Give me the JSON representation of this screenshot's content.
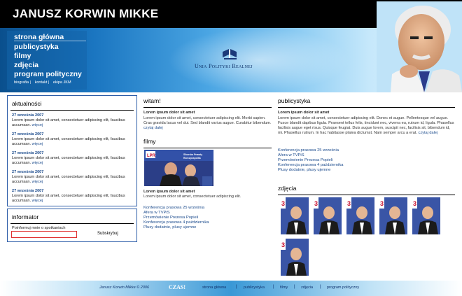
{
  "header": {
    "title": "JANUSZ KORWIN MIKKE",
    "logo_text": "Unia Polityki Realnej",
    "nav": [
      "strona główna",
      "publicystyka",
      "filmy",
      "zdjęcia",
      "program polityczny"
    ],
    "subnav": [
      "biografia",
      "kontakt",
      "ekipa JKM"
    ]
  },
  "aktualnosci": {
    "title": "aktualności",
    "items": [
      {
        "date": "27 września 2007",
        "text": "Lorem ipsum dolor sit amet, consectetuer adipiscing elit, faucibus accumsan.",
        "more": "więcej"
      },
      {
        "date": "27 września 2007",
        "text": "Lorem ipsum dolor sit amet, consectetuer adipiscing elit, faucibus accumsan.",
        "more": "więcej"
      },
      {
        "date": "27 września 2007",
        "text": "Lorem ipsum dolor sit amet, consectetuer adipiscing elit, faucibus accumsan.",
        "more": "więcej"
      },
      {
        "date": "27 września 2007",
        "text": "Lorem ipsum dolor sit amet, consectetuer adipiscing elit, faucibus accumsan.",
        "more": "więcej"
      },
      {
        "date": "27 września 2007",
        "text": "Lorem ipsum dolor sit amet, consectetuer adipiscing elit, faucibus accumsan.",
        "more": "więcej"
      }
    ]
  },
  "informator": {
    "title": "informator",
    "label": "Poinformuj mnie o spotkaniach",
    "input_value": "",
    "button": "Subskrybuj"
  },
  "witam": {
    "title": "witam!",
    "art_title": "Lorem ipsum dolor sit amet",
    "text": "Lorem ipsum dolor sit amet, consectetuer adipiscing elit. Morbi sapien. Cras gravida lacus vel dui. Sed blandit varius augue. Curabitur bibendum.",
    "more": "czytaj dalej"
  },
  "filmy": {
    "title": "filmy",
    "art_title": "Lorem ipsum dolor sit amet",
    "text": "Lorem ipsum dolor sit amet, consectetuer adipiscing elit.",
    "links": [
      "Konferencja prasowa 25 września",
      "Afera w TVPiS",
      "Przemówienie Prezesa Popieli",
      "Konferencja prasowa 4 października",
      "Plusy dodatnie, plusy ujemne"
    ]
  },
  "publicystyka": {
    "title": "publicystyka",
    "art_title": "Lorem ipsum dolor sit amet",
    "text": "Lorem ipsum dolor sit amet, consectetuer adipiscing elit. Donec et augue. Pellentesque vel augue. Fusce blandit dapibus ligula. Praesent tellus felis, tincidunt nec, viverra eu, rutrum id, ligula. Phasellus facilisis augue eget risus. Quisque feugiat. Duis augue lorem, suscipit nec, facilisis sit, bibendum id, mi. Phasellus rutrum. In hac habitasse platea dictumst. Nam semper arcu a erat.",
    "more": "czytaj dalej",
    "links": [
      "Konferencja prasowa 25 września",
      "Afera w TVPiS",
      "Przemówienie Prezesa Popieli",
      "Konferencja prasowa 4 października",
      "Plusy dodatnie, plusy ujemne"
    ]
  },
  "zdjecia": {
    "title": "zdjęcia"
  },
  "footer": {
    "copyright": "Janusz Korwin Mikke © 2006",
    "logo": "CZAS!",
    "links": [
      "strona główna",
      "publicystyka",
      "filmy",
      "zdjęcia",
      "program polityczny"
    ]
  },
  "colors": {
    "link": "#1a4a8c",
    "box_border": "#2d5da8",
    "header_bg": "#000000"
  }
}
